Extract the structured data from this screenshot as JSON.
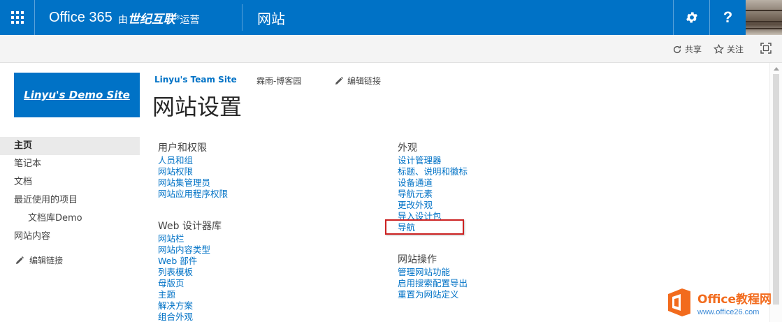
{
  "suite_bar": {
    "brand": "Office 365",
    "brand_sub_prefix": "由",
    "brand_sub_bold": "世纪互联",
    "brand_sub_mark": "®",
    "brand_sub_suffix": "运营",
    "app_name": "网站",
    "help_label": "?",
    "colors": {
      "background": "#0072c6",
      "text": "#ffffff"
    }
  },
  "action_bar": {
    "share_label": "共享",
    "follow_label": "关注",
    "icons": [
      "share-icon",
      "star-icon",
      "focus-content-icon"
    ]
  },
  "site_logo": {
    "text": "Linyu's Demo Site"
  },
  "top_nav": {
    "root": "Linyu's Team Site",
    "sub_site": "霖雨-博客园",
    "edit_links": "编辑链接"
  },
  "page_title": "网站设置",
  "quick_launch": {
    "items": [
      {
        "label": "主页",
        "selected": true
      },
      {
        "label": "笔记本"
      },
      {
        "label": "文档"
      },
      {
        "label": "最近使用的项目"
      },
      {
        "label": "文档库Demo",
        "child": true
      },
      {
        "label": "网站内容"
      }
    ],
    "edit_links": "编辑链接"
  },
  "settings": {
    "users": {
      "title": "用户和权限",
      "links": [
        "人员和组",
        "网站权限",
        "网站集管理员",
        "网站应用程序权限"
      ]
    },
    "web_designer": {
      "title": "Web 设计器库",
      "links": [
        "网站栏",
        "网站内容类型",
        "Web 部件",
        "列表模板",
        "母版页",
        "主题",
        "解决方案",
        "组合外观"
      ]
    },
    "look_and_feel": {
      "title": "外观",
      "links": [
        "设计管理器",
        "标题、说明和徽标",
        "设备通道",
        "导航元素",
        "更改外观",
        "导入设计包",
        "导航"
      ]
    },
    "site_actions": {
      "title": "网站操作",
      "links": [
        "管理网站功能",
        "启用搜索配置导出",
        "重置为网站定义"
      ]
    }
  },
  "highlight_target": "导航",
  "watermark": {
    "brand": "Office教程网",
    "url": "www.office26.com"
  },
  "colors": {
    "link": "#0072c6",
    "highlight": "#cc2222",
    "watermark_orange": "#f26b1d"
  }
}
